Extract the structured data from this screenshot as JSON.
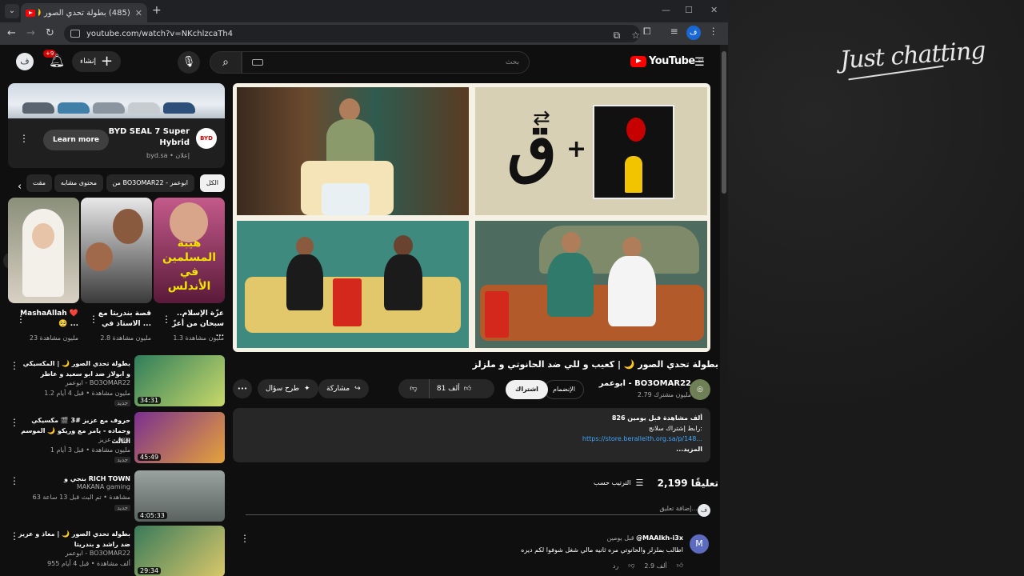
{
  "browser": {
    "tab_title": "(485) بطولة تحدي الصور 🌙",
    "tab_close": "✕",
    "new_tab": "+",
    "url": "youtube.com/watch?v=NKchlzcaTh4",
    "profile_initial": "ف",
    "window_controls": [
      "—",
      "☐",
      "✕"
    ]
  },
  "right_panel": {
    "logo_text": "Just chatting"
  },
  "header": {
    "avatar_initial": "ف",
    "notification_badge": "+9",
    "create_label": "إنشاء",
    "search_placeholder": "بحث",
    "logo_text": "YouTube",
    "region": "SA"
  },
  "ad": {
    "learn_more": "Learn more",
    "title": "BYD SEAL 7 Super Hybrid",
    "sponsor": "إعلان",
    "domain": "byd.sa",
    "logo_text": "BYD"
  },
  "chips": [
    {
      "label": "الكل",
      "active": true
    },
    {
      "label": "من BO3OMAR22 - ابوعمر",
      "active": false
    },
    {
      "label": "محتوى مشابه",
      "active": false
    },
    {
      "label": "مقت",
      "active": false
    }
  ],
  "shorts": [
    {
      "title": "عزّة الإسلام.. سبحان من أعزّ ...",
      "views": "1.3 مليون مشاهدة",
      "overlay": "هيبة المسلمين في الأندلس"
    },
    {
      "title": "قصة بندريتا مع الاستاذ في ...",
      "views": "2.8 مليون مشاهدة"
    },
    {
      "title": "MashaAllah ❤️🥺 ...",
      "views": "23 مليون مشاهدة"
    }
  ],
  "recommendations": [
    {
      "title": "بطولة تحدي الصور 🌙 | المكسيكي و ابولاز ضد ابو سعيد و عاطر",
      "channel": "ابوعمر - BO3OMAR22",
      "meta": "1.2 مليون مشاهدة • قبل 4 أيام",
      "badge": "جديد",
      "duration": "34:31"
    },
    {
      "title": "حروف مع عزيز #3 🎬 مكسيكي وحماده - يامر مع وريكو 🌙 الموسم الثالث",
      "channel": "عزيز - Aziz",
      "meta": "1 مليون مشاهدة • قبل 3 أيام",
      "badge": "جديد",
      "duration": "45:49"
    },
    {
      "title": "بنجي و RICH TOWN",
      "channel": "MAKANA gaming",
      "meta": "63 مشاهدة • تم البث قبل 13 ساعة",
      "badge": "جديد",
      "duration": "4:05:33"
    },
    {
      "title": "بطولة تحدي الصور 🌙 | معاذ و عزيز ضد راشد و بندريتا",
      "channel": "ابوعمر - BO3OMAR22",
      "meta": "955 ألف مشاهدة • قبل 4 أيام",
      "badge": "",
      "duration": "29:34"
    }
  ],
  "video": {
    "title": "بطولة تحدي الصور 🌙 | كعيب و للي ضد الحانوتي و ملزلز",
    "channel": "ابوعمر - BO3OMAR22",
    "subscribers": "2.79 مليون مشترك",
    "join": "الإنضمام",
    "subscribe": "اشتراك",
    "likes": "81 ألف",
    "share": "مشاركة",
    "ask": "طرح سؤال",
    "more": "•••",
    "overlay_letter": "ق"
  },
  "description": {
    "stats": "826 ألف مشاهدة  قبل يومين",
    "line1": "رابط إشتراك سلانج:",
    "link": "https://store.beralleith.org.sa/p/148...",
    "more": "...المزيد"
  },
  "comments": {
    "count": "2,199 تعليقًا",
    "sort": "الترتيب حسب",
    "add_placeholder": "إضافة تعليق...",
    "user_initial": "ف",
    "first": {
      "author": "@MAAlkh-i3x",
      "time": "قبل يومين",
      "text": "اطالب بملزلز والحانوتي مره ثانيه مالي شغل شوفوا لكم ديره",
      "likes": "2.9 ألف",
      "reply": "رد",
      "avatar": "M"
    }
  }
}
